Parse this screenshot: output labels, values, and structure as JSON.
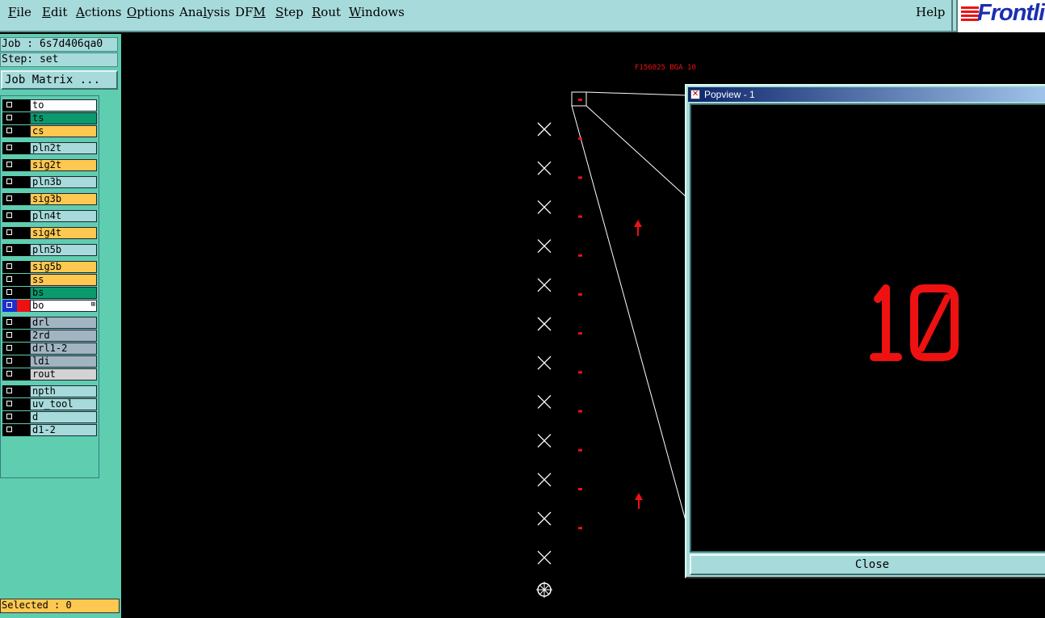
{
  "menubar": {
    "items": [
      {
        "pre": "",
        "u": "F",
        "post": "ile"
      },
      {
        "pre": "",
        "u": "E",
        "post": "dit"
      },
      {
        "pre": "",
        "u": "A",
        "post": "ctions"
      },
      {
        "pre": "",
        "u": "O",
        "post": "ptions"
      },
      {
        "pre": "Ana",
        "u": "l",
        "post": "ysis"
      },
      {
        "pre": "DF",
        "u": "M",
        "post": ""
      },
      {
        "pre": "",
        "u": "S",
        "post": "tep"
      },
      {
        "pre": "",
        "u": "R",
        "post": "out"
      },
      {
        "pre": "",
        "u": "W",
        "post": "indows"
      }
    ],
    "help": "Help",
    "logo": "Frontli"
  },
  "sidebar": {
    "job": "Job : 6s7d406qa0",
    "step": "Step: set",
    "job_matrix": "Job Matrix ...",
    "selected": "Selected : 0",
    "colors": {
      "white": "#ffffff",
      "green": "#0a9a6c",
      "orange": "#ffc850",
      "teal": "#a7dada",
      "grey": "#a2b4c2",
      "lightgrey": "#d3d3d3"
    },
    "layers": [
      {
        "name": "to",
        "color": "white"
      },
      {
        "name": "ts",
        "color": "green"
      },
      {
        "name": "cs",
        "color": "orange"
      },
      {
        "name": "pln2t",
        "color": "teal"
      },
      {
        "name": "sig2t",
        "color": "orange"
      },
      {
        "name": "pln3b",
        "color": "teal"
      },
      {
        "name": "sig3b",
        "color": "orange"
      },
      {
        "name": "pln4t",
        "color": "teal"
      },
      {
        "name": "sig4t",
        "color": "orange"
      },
      {
        "name": "pln5b",
        "color": "teal"
      },
      {
        "name": "sig5b",
        "color": "orange"
      },
      {
        "name": "ss",
        "color": "orange"
      },
      {
        "name": "bs",
        "color": "green"
      },
      {
        "name": "bo",
        "color": "white",
        "active": true
      },
      {
        "name": "drl",
        "color": "grey"
      },
      {
        "name": "2rd",
        "color": "grey"
      },
      {
        "name": "drl1-2",
        "color": "grey"
      },
      {
        "name": "ldi",
        "color": "grey"
      },
      {
        "name": "rout",
        "color": "lightgrey"
      },
      {
        "name": "npth",
        "color": "teal"
      },
      {
        "name": "uv_tool",
        "color": "teal"
      },
      {
        "name": "d",
        "color": "teal"
      },
      {
        "name": "d1-2",
        "color": "teal"
      }
    ]
  },
  "popview": {
    "title": "Popview - 1",
    "zoom_text": "10",
    "close": "Close"
  },
  "canvas": {
    "header_text": "F156025 BGA 10"
  }
}
